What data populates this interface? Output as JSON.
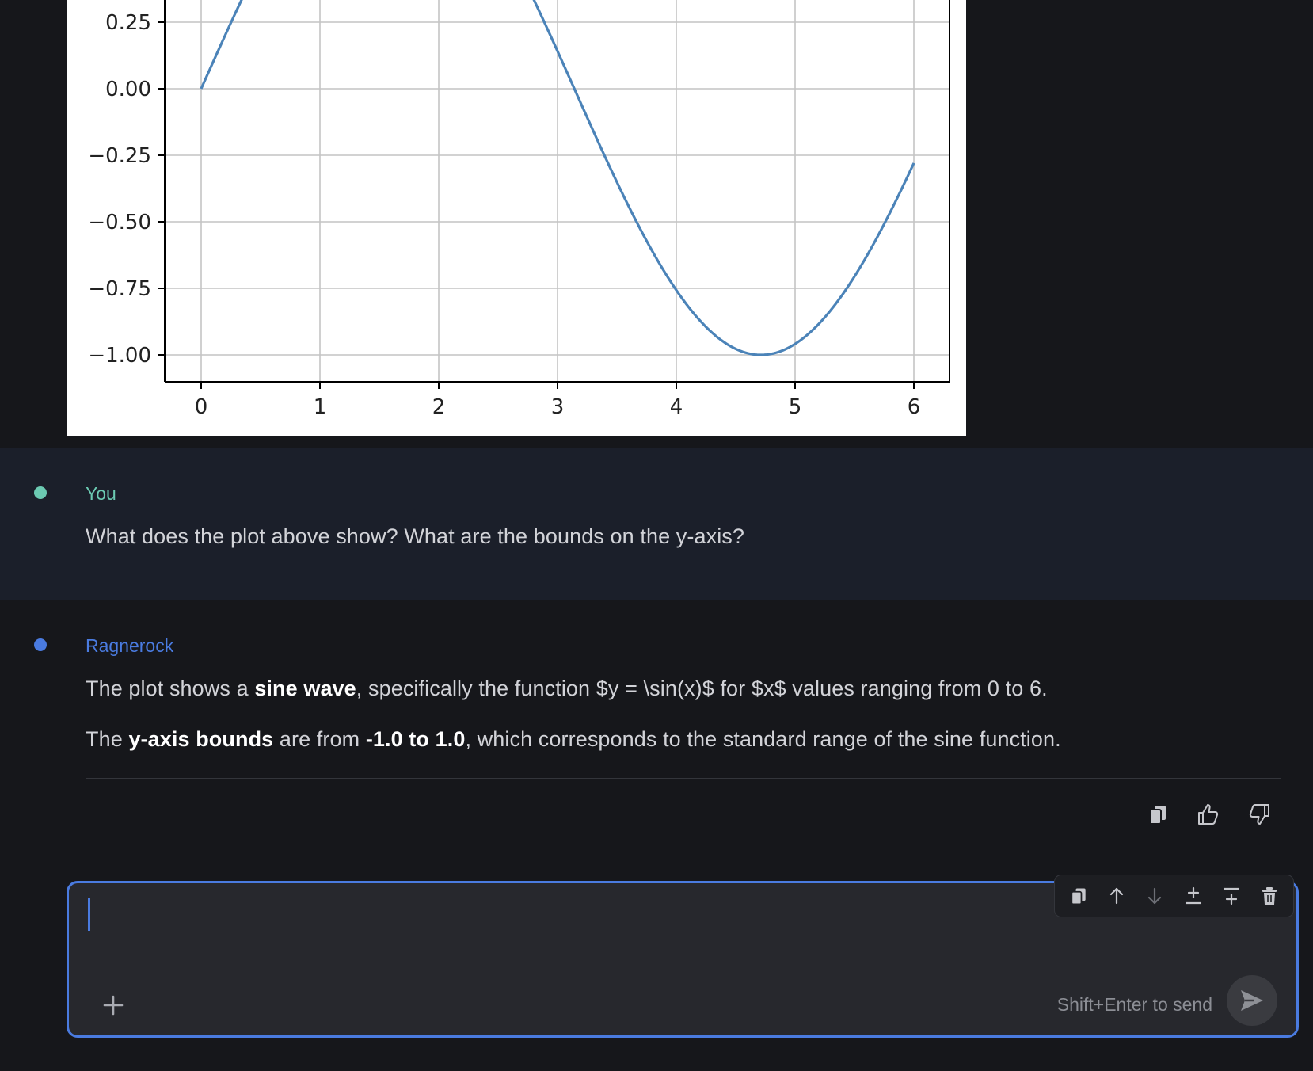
{
  "chart_data": {
    "type": "line",
    "title": "",
    "xlabel": "",
    "ylabel": "",
    "xlim": [
      -0.3,
      6.3
    ],
    "ylim_visible": [
      -1.1,
      0.35
    ],
    "grid": true,
    "x_ticks": [
      0,
      1,
      2,
      3,
      4,
      5,
      6
    ],
    "x_tick_labels": [
      "0",
      "1",
      "2",
      "3",
      "4",
      "5",
      "6"
    ],
    "y_ticks": [
      0.25,
      0.0,
      -0.25,
      -0.5,
      -0.75,
      -1.0
    ],
    "y_tick_labels": [
      "0.25",
      "0.00",
      "−0.25",
      "−0.50",
      "−0.75",
      "−1.00"
    ],
    "function": "sin(x)",
    "x_range": [
      0,
      6
    ],
    "line_color": "#4b83b8"
  },
  "messages": {
    "user": {
      "author": "You",
      "author_color": "#6ccab2",
      "text": "What does the plot above show? What are the bounds on the y-axis?"
    },
    "assistant": {
      "author": "Ragnerock",
      "author_color": "#4a7be0",
      "p1_pre": "The plot shows a ",
      "p1_bold": "sine wave",
      "p1_post": ", specifically the function $y = \\sin(x)$ for $x$ values ranging from 0 to 6.",
      "p2_pre": "The ",
      "p2_bold1": "y-axis bounds",
      "p2_mid": " are from ",
      "p2_bold2": "-1.0 to 1.0",
      "p2_post": ", which corresponds to the standard range of the sine function."
    }
  },
  "feedback": {
    "copy_icon": "copy-icon",
    "like_icon": "thumbs-up-icon",
    "dislike_icon": "thumbs-down-icon"
  },
  "composer": {
    "value": "",
    "hint": "Shift+Enter to send",
    "toolbar_icons": [
      "copy-icon",
      "arrow-up-icon",
      "arrow-down-icon",
      "insert-below-icon",
      "insert-above-icon",
      "trash-icon"
    ]
  }
}
